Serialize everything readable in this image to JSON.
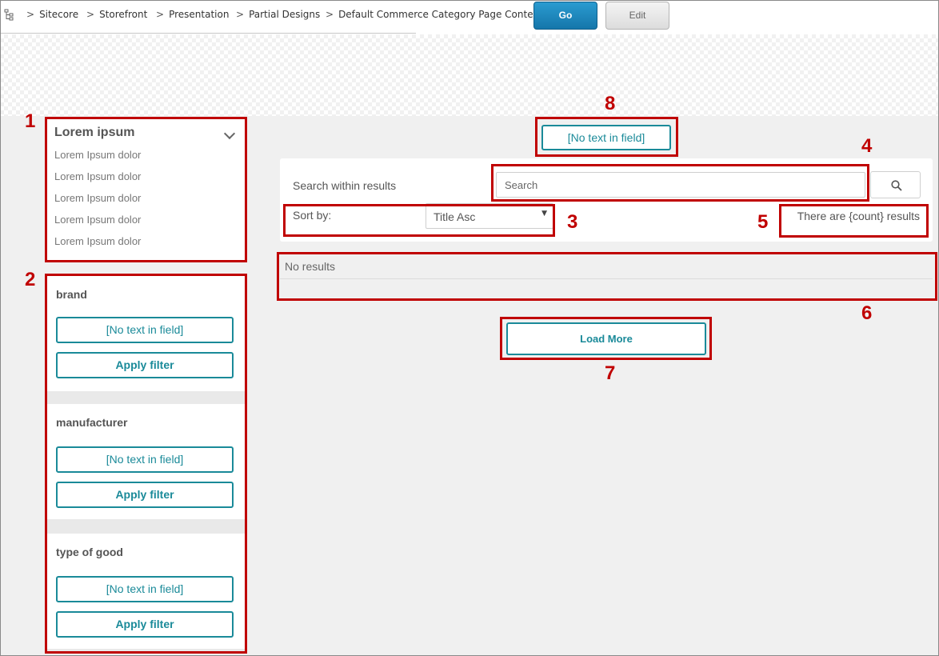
{
  "breadcrumb": [
    "Sitecore",
    "Storefront",
    "Presentation",
    "Partial Designs",
    "Default Commerce Category Page Content"
  ],
  "toolbar": {
    "go_label": "Go",
    "edit_label": "Edit"
  },
  "category": {
    "title": "Lorem ipsum",
    "items": [
      "Lorem Ipsum dolor",
      "Lorem Ipsum dolor",
      "Lorem Ipsum dolor",
      "Lorem Ipsum dolor",
      "Lorem Ipsum dolor"
    ]
  },
  "facets": [
    {
      "title": "brand",
      "field_label": "[No text in field]",
      "apply_label": "Apply filter"
    },
    {
      "title": "manufacturer",
      "field_label": "[No text in field]",
      "apply_label": "Apply filter"
    },
    {
      "title": "type of good",
      "field_label": "[No text in field]",
      "apply_label": "Apply filter"
    }
  ],
  "top_field_label": "[No text in field]",
  "search": {
    "within_label": "Search within results",
    "placeholder": "Search",
    "sort_label": "Sort by:",
    "sort_value": "Title Asc",
    "count_text": "There are {count} results"
  },
  "results": {
    "empty_text": "No results"
  },
  "load_more_label": "Load More",
  "annotations": [
    "1",
    "2",
    "3",
    "4",
    "5",
    "6",
    "7",
    "8"
  ],
  "colors": {
    "annotation": "#c00000",
    "accent": "#1a8a99",
    "go_button": "#1576aa"
  }
}
